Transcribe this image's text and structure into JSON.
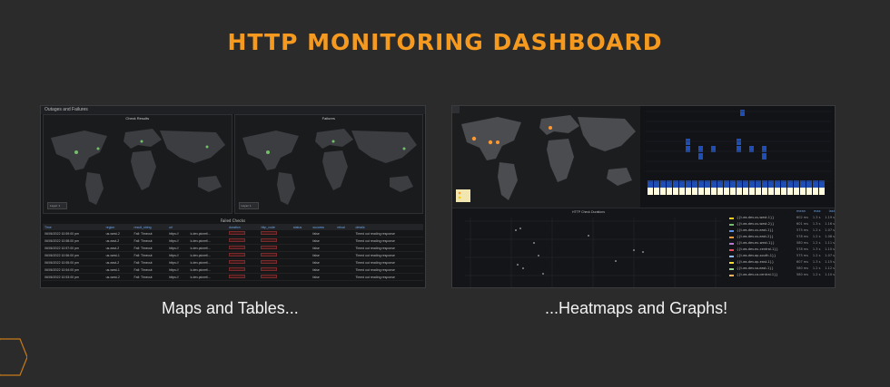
{
  "slide": {
    "title": "HTTP MONITORING DASHBOARD",
    "caption_left": "Maps and Tables...",
    "caption_right": "...Heatmaps and Graphs!"
  },
  "left_panel": {
    "header": "Outages and Failures",
    "map_left_title": "Check Results",
    "map_right_title": "Failures",
    "legend_label": "Layer 1",
    "table_title": "Failed Checks",
    "columns": [
      "Time",
      "region",
      "result_string",
      "url",
      "",
      "duration",
      "http_code",
      "status",
      "success",
      "retval",
      "details"
    ],
    "rows": [
      [
        "06/06/2022 10:59:00 pm",
        "us-west-2",
        "Fail: Timeout",
        "https://",
        "k.dev.picnet/...",
        "",
        "",
        "",
        "false",
        "",
        "Timed out reading response"
      ],
      [
        "06/06/2022 10:58:00 pm",
        "us-east-2",
        "Fail: Timeout",
        "https://",
        "k.dev.picnet/...",
        "",
        "",
        "",
        "false",
        "",
        "Timed out reading response"
      ],
      [
        "06/06/2022 10:57:00 pm",
        "us-east-2",
        "Fail: Timeout",
        "https://",
        "k.dev.picnet/...",
        "",
        "",
        "",
        "false",
        "",
        "Timed out reading response"
      ],
      [
        "06/06/2022 10:56:00 pm",
        "us-west-1",
        "Fail: Timeout",
        "https://",
        "k.dev.picnet/...",
        "",
        "",
        "",
        "false",
        "",
        "Timed out reading response"
      ],
      [
        "06/06/2022 10:55:00 pm",
        "us-east-2",
        "Fail: Timeout",
        "https://",
        "k.dev.picnet/...",
        "",
        "",
        "",
        "false",
        "",
        "Timed out reading response"
      ],
      [
        "06/06/2022 10:54:00 pm",
        "us-west-1",
        "Fail: Timeout",
        "https://",
        "k.dev.picnet/...",
        "",
        "",
        "",
        "false",
        "",
        "Timed out reading response"
      ],
      [
        "06/06/2022 10:53:00 pm",
        "us-west-2",
        "Fail: Timeout",
        "https://",
        "k.dev.picnet/...",
        "",
        "",
        "",
        "false",
        "",
        "Timed out reading response"
      ]
    ]
  },
  "right_panel": {
    "graph_title": "HTTP Check Durations",
    "legend_headers": [
      "mean",
      "max",
      "last"
    ],
    "legend_rows": [
      {
        "name": "{{t.ws.dev.us-west-1}}",
        "color": "#f2cc0c",
        "mean": "602 ms",
        "max": "1.3 s",
        "last": "1.19 s"
      },
      {
        "name": "{{t.ws.dev.us-west-2}}",
        "color": "#73bf69",
        "mean": "601 ms",
        "max": "1.3 s",
        "last": "1.16 s"
      },
      {
        "name": "{{t.ws.dev.us-east-1}}",
        "color": "#5794f2",
        "mean": "575 ms",
        "max": "1.2 s",
        "last": "1.07 s"
      },
      {
        "name": "{{t.ws.dev.us-east-2}}",
        "color": "#ff9830",
        "mean": "578 ms",
        "max": "1.2 s",
        "last": "1.08 s"
      },
      {
        "name": "{{t.ws.dev.eu-west-1}}",
        "color": "#b877d9",
        "mean": "580 ms",
        "max": "1.2 s",
        "last": "1.11 s"
      },
      {
        "name": "{{t.ws.dev.eu-central-1}}",
        "color": "#f2495c",
        "mean": "578 ms",
        "max": "1.3 s",
        "last": "1.10 s"
      },
      {
        "name": "{{t.ws.dev.ap-south-1}}",
        "color": "#8ab8ff",
        "mean": "575 ms",
        "max": "1.2 s",
        "last": "1.07 s"
      },
      {
        "name": "{{t.ws.dev.ap-east-1}}",
        "color": "#fade2a",
        "mean": "607 ms",
        "max": "1.3 s",
        "last": "1.15 s"
      },
      {
        "name": "{{t.ws.dev.sa-east-1}}",
        "color": "#96d98d",
        "mean": "580 ms",
        "max": "1.2 s",
        "last": "1.12 s"
      },
      {
        "name": "{{t.ws.dev.ca-central-1}}",
        "color": "#ffb357",
        "mean": "580 ms",
        "max": "1.2 s",
        "last": "1.10 s"
      }
    ]
  },
  "colors": {
    "accent": "#f59a1f",
    "background": "#2b2b2c",
    "heat_low": "#fffbdc",
    "heat_high": "#1f4fb5"
  }
}
